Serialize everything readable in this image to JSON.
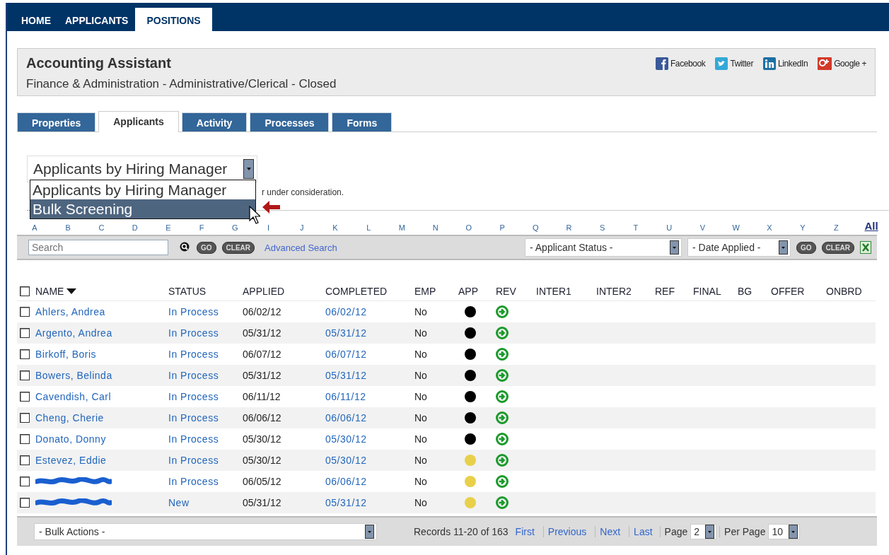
{
  "nav_tabs": [
    {
      "label": "HOME",
      "selected": false
    },
    {
      "label": "APPLICANTS",
      "selected": false
    },
    {
      "label": "POSITIONS",
      "selected": true
    }
  ],
  "position": {
    "title": "Accounting Assistant",
    "subtitle": "Finance & Administration - Administrative/Clerical - Closed"
  },
  "share_links": [
    {
      "label": "Facebook",
      "kind": "facebook"
    },
    {
      "label": "Twitter",
      "kind": "twitter"
    },
    {
      "label": "LinkedIn",
      "kind": "linkedin"
    },
    {
      "label": "Google +",
      "kind": "googleplus"
    }
  ],
  "tabs": [
    {
      "label": "Properties",
      "selected": false
    },
    {
      "label": "Applicants",
      "selected": true
    },
    {
      "label": "Activity",
      "selected": false
    },
    {
      "label": "Processes",
      "selected": false
    },
    {
      "label": "Forms",
      "selected": false
    }
  ],
  "view_select": {
    "value": "Applicants by Hiring Manager",
    "expanded": true,
    "options": [
      {
        "label": "Applicants by Hiring Manager",
        "highlighted": false
      },
      {
        "label": "Bulk Screening",
        "highlighted": true
      }
    ]
  },
  "note": "r under consideration.",
  "alphabet": [
    "A",
    "B",
    "C",
    "D",
    "E",
    "F",
    "G",
    "I",
    "J",
    "K",
    "L",
    "M",
    "N",
    "O",
    "P",
    "Q",
    "R",
    "S",
    "T",
    "U",
    "V",
    "W",
    "X",
    "Y",
    "Z"
  ],
  "all_link": "All",
  "search": {
    "placeholder": "Search",
    "go": "GO",
    "clear": "CLEAR",
    "advanced": "Advanced Search"
  },
  "filters": {
    "status": "- Applicant Status -",
    "date": "- Date Applied -",
    "go": "GO",
    "clear": "CLEAR"
  },
  "table": {
    "header_checked": false,
    "columns": [
      {
        "label": "NAME",
        "sorted": true
      },
      {
        "label": "STATUS"
      },
      {
        "label": "APPLIED"
      },
      {
        "label": "COMPLETED"
      },
      {
        "label": "EMP"
      },
      {
        "label": "APP"
      },
      {
        "label": "REV"
      },
      {
        "label": "INTER1"
      },
      {
        "label": "INTER2"
      },
      {
        "label": "REF"
      },
      {
        "label": "FINAL"
      },
      {
        "label": "BG"
      },
      {
        "label": "OFFER"
      },
      {
        "label": "ONBRD"
      }
    ],
    "rows": [
      {
        "checked": false,
        "name": "Ahlers, Andrea",
        "status": "In Process",
        "applied": "06/02/12",
        "completed": "06/02/12",
        "emp": "No",
        "color": "#000000"
      },
      {
        "checked": false,
        "name": "Argento, Andrea",
        "status": "In Process",
        "applied": "05/31/12",
        "completed": "05/31/12",
        "emp": "No",
        "color": "#000000"
      },
      {
        "checked": false,
        "name": "Birkoff, Boris",
        "status": "In Process",
        "applied": "06/07/12",
        "completed": "06/07/12",
        "emp": "No",
        "color": "#000000"
      },
      {
        "checked": false,
        "name": "Bowers, Belinda",
        "status": "In Process",
        "applied": "05/31/12",
        "completed": "05/31/12",
        "emp": "No",
        "color": "#000000"
      },
      {
        "checked": false,
        "name": "Cavendish, Carl",
        "status": "In Process",
        "applied": "06/11/12",
        "completed": "06/11/12",
        "emp": "No",
        "color": "#000000"
      },
      {
        "checked": false,
        "name": "Cheng, Cherie",
        "status": "In Process",
        "applied": "06/06/12",
        "completed": "06/06/12",
        "emp": "No",
        "color": "#000000"
      },
      {
        "checked": false,
        "name": "Donato, Donny",
        "status": "In Process",
        "applied": "05/30/12",
        "completed": "05/30/12",
        "emp": "No",
        "color": "#000000"
      },
      {
        "checked": false,
        "name": "Estevez, Eddie",
        "status": "In Process",
        "applied": "05/30/12",
        "completed": "05/30/12",
        "emp": "No",
        "color": "#e8d04a"
      },
      {
        "checked": false,
        "redacted": true,
        "status": "In Process",
        "applied": "06/05/12",
        "completed": "06/06/12",
        "emp": "No",
        "color": "#e8d04a"
      },
      {
        "checked": false,
        "redacted": true,
        "status": "New",
        "applied": "05/31/12",
        "completed": "05/31/12",
        "emp": "No",
        "color": "#e8d04a"
      }
    ]
  },
  "footer": {
    "bulk_actions": "- Bulk Actions -",
    "records": "Records 11-20 of 163",
    "pager": [
      "First",
      "Previous",
      "Next",
      "Last"
    ],
    "page_label": "Page",
    "page": "2",
    "per_page_label": "Per Page",
    "per_page": "10"
  }
}
